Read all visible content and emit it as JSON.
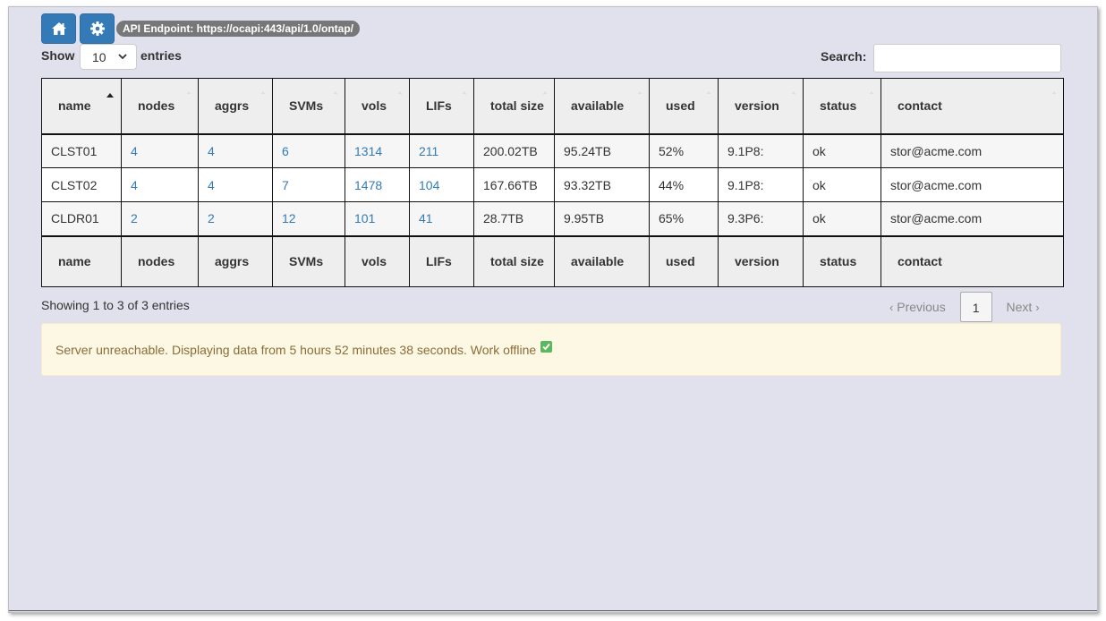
{
  "toolbar": {
    "home_icon": "home-icon",
    "settings_icon": "gear-icon",
    "api_endpoint": "API Endpoint: https://ocapi:443/api/1.0/ontap/"
  },
  "controls": {
    "show_label": "Show",
    "page_length": "10",
    "entries_label": "entries",
    "search_label": "Search:",
    "search_value": ""
  },
  "table": {
    "columns": [
      "name",
      "nodes",
      "aggrs",
      "SVMs",
      "vols",
      "LIFs",
      "total size",
      "available",
      "used",
      "version",
      "status",
      "contact"
    ],
    "sorted_column": "name",
    "sort_direction": "ascending",
    "rows": [
      [
        "CLST01",
        "4",
        "4",
        "6",
        "1314",
        "211",
        "200.02TB",
        "95.24TB",
        "52%",
        "9.1P8:",
        "ok",
        "stor@acme.com"
      ],
      [
        "CLST02",
        "4",
        "4",
        "7",
        "1478",
        "104",
        "167.66TB",
        "93.32TB",
        "44%",
        "9.1P8:",
        "ok",
        "stor@acme.com"
      ],
      [
        "CLDR01",
        "2",
        "2",
        "12",
        "101",
        "41",
        "28.7TB",
        "9.95TB",
        "65%",
        "9.3P6:",
        "ok",
        "stor@acme.com"
      ]
    ]
  },
  "footer": {
    "info": "Showing 1 to 3 of 3 entries",
    "previous": "Previous",
    "current_page": "1",
    "next": "Next"
  },
  "alert": {
    "message": "Server unreachable. Displaying data from 5 hours 52 minutes 38 seconds. Work offline",
    "checkbox_checked": true
  },
  "colors": {
    "background": "#e1e1ee",
    "primary": "#337ab7",
    "link": "#337ab7",
    "alert_bg": "#fcf8e3",
    "alert_text": "#8a6d3b",
    "check": "#5cb85c"
  }
}
